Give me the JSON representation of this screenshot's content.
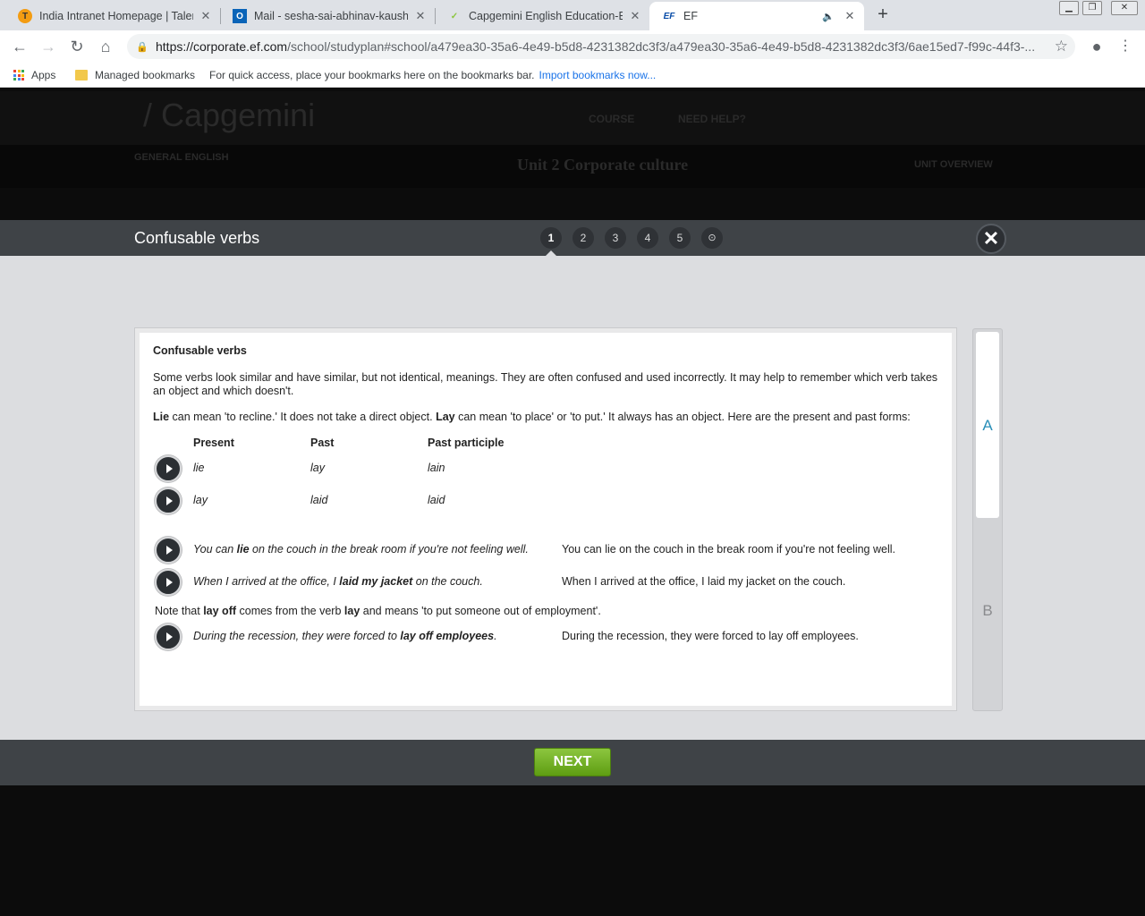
{
  "browser": {
    "tabs": [
      {
        "title": "India Intranet Homepage | Talent",
        "favicon": "T"
      },
      {
        "title": "Mail - sesha-sai-abhinav-kaushal",
        "favicon": "O"
      },
      {
        "title": "Capgemini English Education-EF",
        "favicon": "✓"
      },
      {
        "title": "EF",
        "favicon": "EF"
      }
    ],
    "url_host": "https://corporate.ef.com",
    "url_path": "/school/studyplan#school/a479ea30-35a6-4e49-b5d8-4231382dc3f3/a479ea30-35a6-4e49-b5d8-4231382dc3f3/6ae15ed7-f99c-44f3-...",
    "bookmarks": {
      "apps": "Apps",
      "managed": "Managed bookmarks",
      "hint": "For quick access, place your bookmarks here on the bookmarks bar.",
      "import_link": "Import bookmarks now..."
    }
  },
  "background_page": {
    "logo": "/ Capgemini",
    "nav": [
      "COURSE",
      "NEED HELP?"
    ],
    "course": "GENERAL ENGLISH",
    "unit": "Unit 2  Corporate culture",
    "overview": "UNIT OVERVIEW"
  },
  "modal": {
    "title": "Confusable verbs",
    "steps": [
      "1",
      "2",
      "3",
      "4",
      "5",
      "⊙"
    ],
    "active_step": "1",
    "next_label": "NEXT",
    "side_tabs": {
      "a": "A",
      "b": "B"
    }
  },
  "content": {
    "heading": "Confusable verbs",
    "intro": "Some verbs look similar and have similar, but not identical, meanings. They are often confused and used incorrectly. It may help to remember which verb takes an object and which doesn't.",
    "lie_word": "Lie",
    "lie_text": " can mean 'to recline.' It does not take a direct object. ",
    "lay_word": "Lay",
    "lay_text": " can mean 'to place' or 'to put.' It always has an object. Here are the present and past forms:",
    "table_headers": {
      "present": "Present",
      "past": "Past",
      "participle": "Past participle"
    },
    "forms": [
      {
        "present": "lie",
        "past": "lay",
        "participle": "lain"
      },
      {
        "present": "lay",
        "past": "laid",
        "participle": "laid"
      }
    ],
    "examples": [
      {
        "pre": "You can ",
        "bold": "lie",
        "post": " on the couch in the break room if you're not feeling well.",
        "plain": "You can lie on the couch in the break room if you're not feeling well."
      },
      {
        "pre": "When I arrived at the office, I ",
        "bold": "laid my jacket",
        "post": " on the couch.",
        "plain": "When I arrived at the office, I laid my jacket on the couch."
      }
    ],
    "note": {
      "pre": "Note that ",
      "bold1": "lay off",
      "mid": " comes from the verb ",
      "bold2": "lay",
      "post": " and means 'to put someone out of employment'."
    },
    "note_example": {
      "pre": "During the recession, they were forced to ",
      "bold": "lay off employees",
      "post": ".",
      "plain": "During the recession, they were forced to lay off employees."
    }
  }
}
